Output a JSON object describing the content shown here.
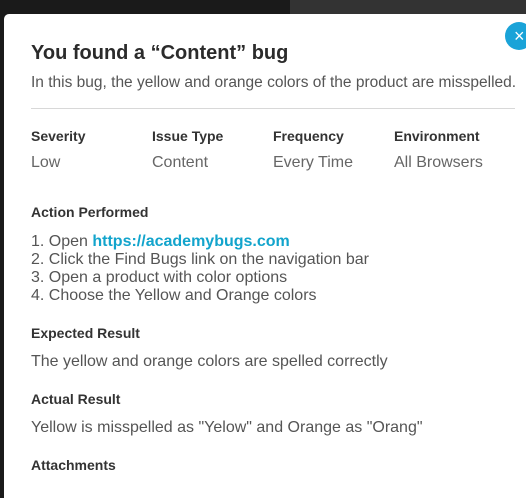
{
  "modal": {
    "close_icon": "×",
    "title": "You found a “Content” bug",
    "description": "In this bug, the yellow and orange colors of the product are misspelled.",
    "meta": [
      {
        "label": "Severity",
        "value": "Low"
      },
      {
        "label": "Issue Type",
        "value": "Content"
      },
      {
        "label": "Frequency",
        "value": "Every Time"
      },
      {
        "label": "Environment",
        "value": "All Browsers"
      }
    ],
    "action_performed": {
      "title": "Action Performed",
      "steps": [
        {
          "prefix": "1. Open ",
          "link": "https://academybugs.com"
        },
        {
          "text": "2. Click the Find Bugs link on the navigation bar"
        },
        {
          "text": "3. Open a product with color options"
        },
        {
          "text": "4. Choose the Yellow and Orange colors"
        }
      ]
    },
    "expected_result": {
      "title": "Expected Result",
      "text": "The yellow and orange colors are spelled correctly"
    },
    "actual_result": {
      "title": "Actual Result",
      "text": "Yellow is misspelled as \"Yelow\" and Orange as \"Orang\""
    },
    "attachments": {
      "title": "Attachments"
    }
  },
  "colors": {
    "accent": "#1aa3d8",
    "link": "#12a4cc",
    "title": "#2b2b2b",
    "text": "#555555"
  }
}
